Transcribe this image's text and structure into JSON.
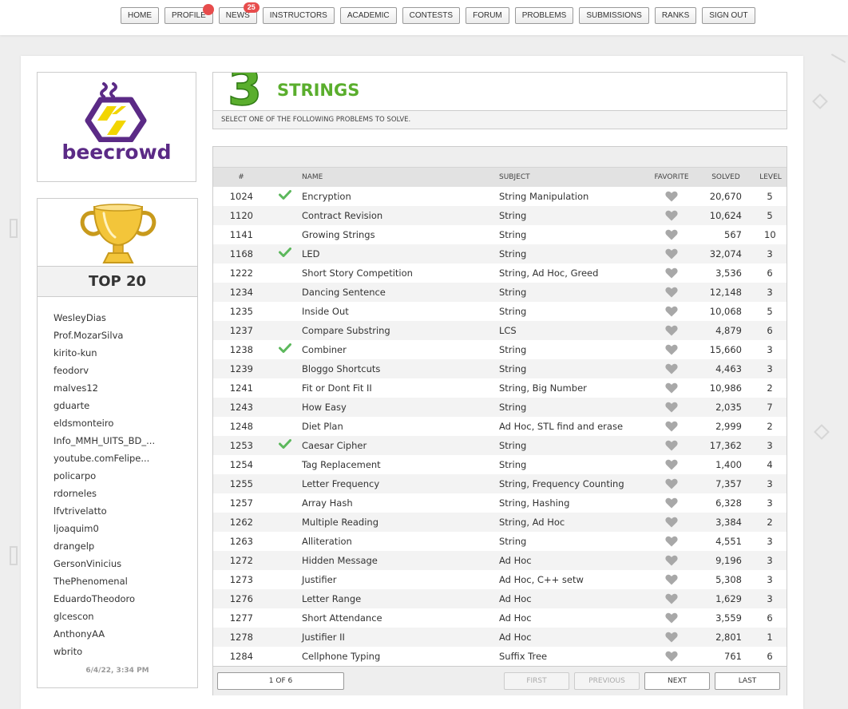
{
  "nav": {
    "items": [
      "HOME",
      "PROFILE",
      "NEWS",
      "INSTRUCTORS",
      "ACADEMIC",
      "CONTESTS",
      "FORUM",
      "PROBLEMS",
      "SUBMISSIONS",
      "RANKS",
      "SIGN OUT"
    ],
    "news_badge": "25"
  },
  "logo": {
    "text": "beecrowd"
  },
  "top20": {
    "title": "TOP 20",
    "users": [
      "WesleyDias",
      "Prof.MozarSilva",
      "kirito-kun",
      "feodorv",
      "malves12",
      "gduarte",
      "eldsmonteiro",
      "Info_MMH_UITS_BD_...",
      "youtube.comFelipe...",
      "policarpo",
      "rdorneles",
      "lfvtrivelatto",
      "ljoaquim0",
      "drangelp",
      "GersonVinicius",
      "ThePhenomenal",
      "EduardoTheodoro",
      "glcescon",
      "AnthonyAA",
      "wbrito"
    ],
    "date": "6/4/22, 3:34 PM"
  },
  "category": {
    "number": "3",
    "title": "STRINGS",
    "subtitle": "SELECT ONE OF THE FOLLOWING PROBLEMS TO SOLVE."
  },
  "table": {
    "headers": {
      "id": "#",
      "name": "NAME",
      "subject": "SUBJECT",
      "favorite": "FAVORITE",
      "solved": "SOLVED",
      "level": "LEVEL"
    },
    "rows": [
      {
        "id": "1024",
        "solved_by_me": true,
        "name": "Encryption",
        "subject": "String Manipulation",
        "solved": "20,670",
        "level": "5"
      },
      {
        "id": "1120",
        "solved_by_me": false,
        "name": "Contract Revision",
        "subject": "String",
        "solved": "10,624",
        "level": "5"
      },
      {
        "id": "1141",
        "solved_by_me": false,
        "name": "Growing Strings",
        "subject": "String",
        "solved": "567",
        "level": "10"
      },
      {
        "id": "1168",
        "solved_by_me": true,
        "name": "LED",
        "subject": "String",
        "solved": "32,074",
        "level": "3"
      },
      {
        "id": "1222",
        "solved_by_me": false,
        "name": "Short Story Competition",
        "subject": "String, Ad Hoc, Greed",
        "solved": "3,536",
        "level": "6"
      },
      {
        "id": "1234",
        "solved_by_me": false,
        "name": "Dancing Sentence",
        "subject": "String",
        "solved": "12,148",
        "level": "3"
      },
      {
        "id": "1235",
        "solved_by_me": false,
        "name": "Inside Out",
        "subject": "String",
        "solved": "10,068",
        "level": "5"
      },
      {
        "id": "1237",
        "solved_by_me": false,
        "name": "Compare Substring",
        "subject": "LCS",
        "solved": "4,879",
        "level": "6"
      },
      {
        "id": "1238",
        "solved_by_me": true,
        "name": "Combiner",
        "subject": "String",
        "solved": "15,660",
        "level": "3"
      },
      {
        "id": "1239",
        "solved_by_me": false,
        "name": "Bloggo Shortcuts",
        "subject": "String",
        "solved": "4,463",
        "level": "3"
      },
      {
        "id": "1241",
        "solved_by_me": false,
        "name": "Fit or Dont Fit II",
        "subject": "String, Big Number",
        "solved": "10,986",
        "level": "2"
      },
      {
        "id": "1243",
        "solved_by_me": false,
        "name": "How Easy",
        "subject": "String",
        "solved": "2,035",
        "level": "7"
      },
      {
        "id": "1248",
        "solved_by_me": false,
        "name": "Diet Plan",
        "subject": "Ad Hoc, STL find and erase",
        "solved": "2,999",
        "level": "2"
      },
      {
        "id": "1253",
        "solved_by_me": true,
        "name": "Caesar Cipher",
        "subject": "String",
        "solved": "17,362",
        "level": "3"
      },
      {
        "id": "1254",
        "solved_by_me": false,
        "name": "Tag Replacement",
        "subject": "String",
        "solved": "1,400",
        "level": "4"
      },
      {
        "id": "1255",
        "solved_by_me": false,
        "name": "Letter Frequency",
        "subject": "String, Frequency Counting",
        "solved": "7,357",
        "level": "3"
      },
      {
        "id": "1257",
        "solved_by_me": false,
        "name": "Array Hash",
        "subject": "String, Hashing",
        "solved": "6,328",
        "level": "3"
      },
      {
        "id": "1262",
        "solved_by_me": false,
        "name": "Multiple Reading",
        "subject": "String, Ad Hoc",
        "solved": "3,384",
        "level": "2"
      },
      {
        "id": "1263",
        "solved_by_me": false,
        "name": "Alliteration",
        "subject": "String",
        "solved": "4,551",
        "level": "3"
      },
      {
        "id": "1272",
        "solved_by_me": false,
        "name": "Hidden Message",
        "subject": "Ad Hoc",
        "solved": "9,196",
        "level": "3"
      },
      {
        "id": "1273",
        "solved_by_me": false,
        "name": "Justifier",
        "subject": "Ad Hoc, C++ setw",
        "solved": "5,308",
        "level": "3"
      },
      {
        "id": "1276",
        "solved_by_me": false,
        "name": "Letter Range",
        "subject": "Ad Hoc",
        "solved": "1,629",
        "level": "3"
      },
      {
        "id": "1277",
        "solved_by_me": false,
        "name": "Short Attendance",
        "subject": "Ad Hoc",
        "solved": "3,559",
        "level": "6"
      },
      {
        "id": "1278",
        "solved_by_me": false,
        "name": "Justifier II",
        "subject": "Ad Hoc",
        "solved": "2,801",
        "level": "1"
      },
      {
        "id": "1284",
        "solved_by_me": false,
        "name": "Cellphone Typing",
        "subject": "Suffix Tree",
        "solved": "761",
        "level": "6"
      }
    ]
  },
  "pagination": {
    "page_label": "1 OF 6",
    "first": "FIRST",
    "previous": "PREVIOUS",
    "next": "NEXT",
    "last": "LAST"
  },
  "colors": {
    "check": "#5cb85c",
    "title": "#5aae2d",
    "logo": "#5b2a86",
    "heart": "#a8a8a8"
  }
}
